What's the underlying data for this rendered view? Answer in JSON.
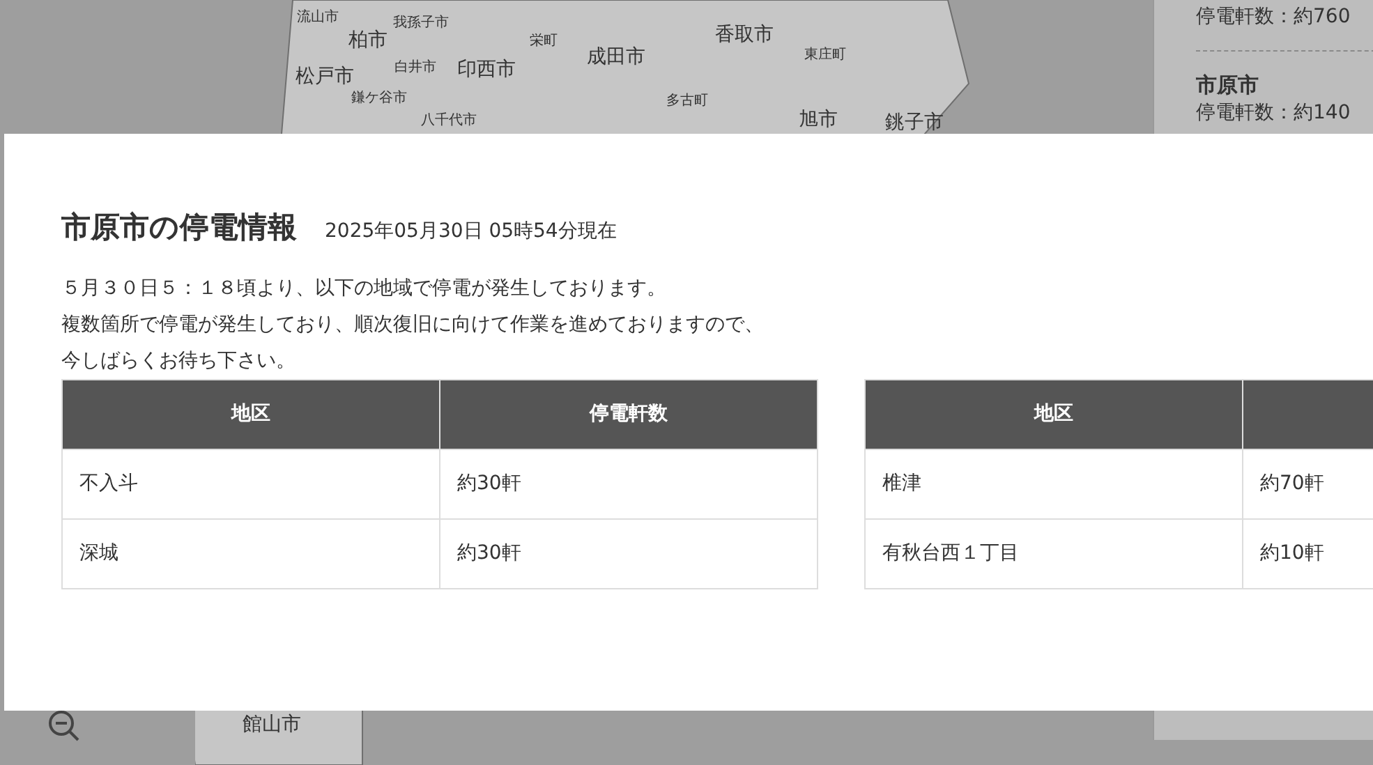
{
  "map": {
    "labels": [
      {
        "text": "流山市"
      },
      {
        "text": "我孫子市"
      },
      {
        "text": "柏市"
      },
      {
        "text": "栄町"
      },
      {
        "text": "成田市"
      },
      {
        "text": "香取市"
      },
      {
        "text": "東庄町"
      },
      {
        "text": "松戸市"
      },
      {
        "text": "白井市"
      },
      {
        "text": "印西市"
      },
      {
        "text": "鎌ケ谷市"
      },
      {
        "text": "多古町"
      },
      {
        "text": "八千代市"
      },
      {
        "text": "旭市"
      },
      {
        "text": "銚子市"
      },
      {
        "text": "館山市"
      }
    ]
  },
  "sidebar": {
    "items": [
      {
        "count": "停電軒数：約760"
      },
      {
        "name": "市原市",
        "count": "停電軒数：約140"
      }
    ]
  },
  "modal": {
    "title": "市原市の停電情報",
    "timestamp": "2025年05月30日 05時54分現在",
    "message": [
      "５月３０日５：１８頃より、以下の地域で停電が発生しております。",
      "複数箇所で停電が発生しており、順次復旧に向けて作業を進めておりますので、",
      "今しばらくお待ち下さい。"
    ],
    "tables": [
      {
        "columns": [
          "地区",
          "停電軒数"
        ],
        "rows": [
          [
            "不入斗",
            "約30軒"
          ],
          [
            "深城",
            "約30軒"
          ]
        ]
      },
      {
        "columns": [
          "地区",
          ""
        ],
        "rows": [
          [
            "椎津",
            "約70軒"
          ],
          [
            "有秋台西１丁目",
            "約10軒"
          ]
        ]
      }
    ]
  }
}
